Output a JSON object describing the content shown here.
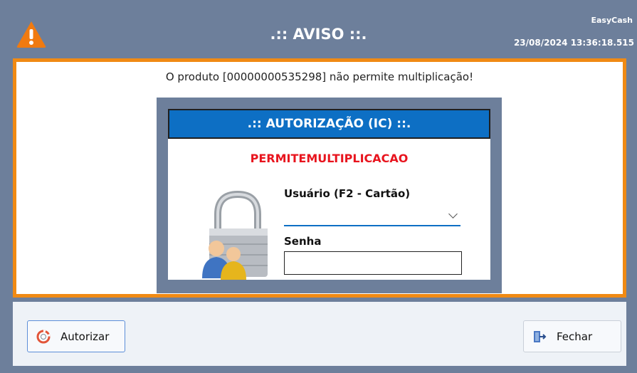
{
  "window": {
    "title": ".:: AVISO ::.",
    "app_name": "EasyCash",
    "datetime": "23/08/2024 13:36:18.515"
  },
  "message": "O produto [00000000535298] não permite multiplicação!",
  "auth": {
    "header": ".:: AUTORIZAÇÃO (IC) ::.",
    "permission": "PERMITEMULTIPLICACAO",
    "user_label": "Usuário (F2 - Cartão)",
    "user_value": "",
    "password_label": "Senha",
    "password_value": ""
  },
  "footer": {
    "authorize_label": "Autorizar",
    "close_label": "Fechar"
  },
  "colors": {
    "frame": "#6d7f9b",
    "accent_orange": "#f08a14",
    "header_blue": "#0d6fc4",
    "permission_red": "#e8141e"
  },
  "icons": [
    "warning-icon",
    "lock-users-icon",
    "lifebuoy-icon",
    "exit-door-icon",
    "chevron-down-icon"
  ]
}
